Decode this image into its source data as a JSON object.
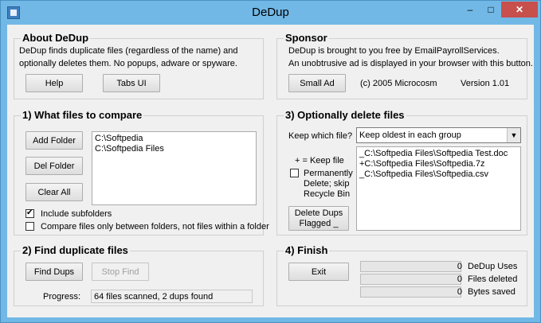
{
  "window": {
    "title": "DeDup",
    "minimize": "–",
    "maximize": "□",
    "close": "✕"
  },
  "about": {
    "title": "About DeDup",
    "line1": "DeDup finds duplicate files (regardless of the name) and",
    "line2": "optionally deletes them.   No popups, adware or spyware.",
    "help_btn": "Help",
    "tabs_btn": "Tabs UI"
  },
  "sponsor": {
    "title": "Sponsor",
    "line1": "DeDup is brought to you free by EmailPayrollServices.",
    "line2": "An unobtrusive ad is displayed in your browser with this button.",
    "ad_btn": "Small Ad",
    "copyright": "(c) 2005 Microcosm",
    "version": "Version 1.01"
  },
  "compare": {
    "title": "1) What files to compare",
    "add_btn": "Add Folder",
    "del_btn": "Del Folder",
    "clear_btn": "Clear All",
    "folders": [
      "C:\\Softpedia",
      "C:\\Softpedia Files"
    ],
    "include_subfolders": "Include subfolders",
    "between_folders": "Compare files only between folders, not files within a folder"
  },
  "delete": {
    "title": "3) Optionally delete files",
    "keep_label": "Keep which file?",
    "keep_value": "Keep oldest in each group",
    "legend": "+ = Keep file",
    "perm_line1": "Permanently",
    "perm_line2": "Delete; skip",
    "perm_line3": "Recycle Bin",
    "delete_btn_line1": "Delete Dups",
    "delete_btn_line2": "Flagged _",
    "files": [
      "_C:\\Softpedia Files\\Softpedia Test.doc",
      "+C:\\Softpedia Files\\Softpedia.7z",
      "_C:\\Softpedia Files\\Softpedia.csv"
    ]
  },
  "find": {
    "title": "2) Find duplicate files",
    "find_btn": "Find Dups",
    "stop_btn": "Stop Find",
    "progress_label": "Progress:",
    "progress_value": "64 files scanned, 2 dups found"
  },
  "finish": {
    "title": "4) Finish",
    "exit_btn": "Exit",
    "stats": [
      {
        "value": "0",
        "label": "DeDup Uses"
      },
      {
        "value": "0",
        "label": "Files deleted"
      },
      {
        "value": "0",
        "label": "Bytes saved"
      }
    ]
  }
}
